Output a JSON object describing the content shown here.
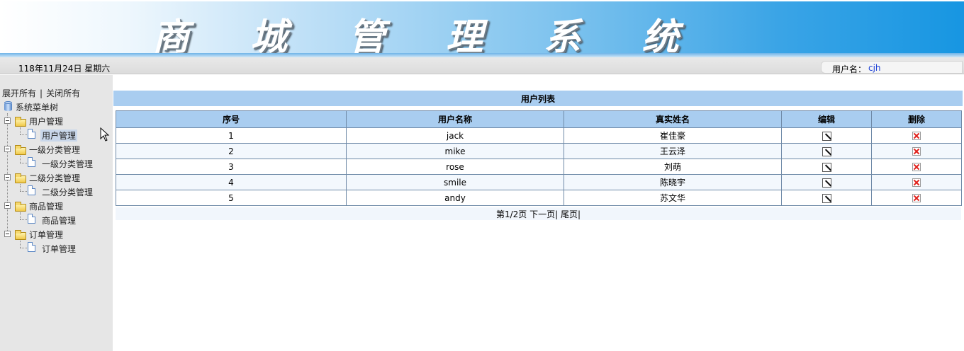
{
  "header": {
    "title": "商 城 管 理 系 统"
  },
  "status_bar": {
    "date": "118年11月24日 星期六",
    "user_label": "用户名：",
    "user_name": "cjh"
  },
  "sidebar": {
    "expand_all": "展开所有",
    "separator": "|",
    "collapse_all": "关闭所有",
    "root_label": "系统菜单树",
    "groups": [
      {
        "label": "用户管理",
        "child": "用户管理"
      },
      {
        "label": "一级分类管理",
        "child": "一级分类管理"
      },
      {
        "label": "二级分类管理",
        "child": "二级分类管理"
      },
      {
        "label": "商品管理",
        "child": "商品管理"
      },
      {
        "label": "订单管理",
        "child": "订单管理"
      }
    ]
  },
  "main": {
    "list_title": "用户列表",
    "columns": [
      "序号",
      "用户名称",
      "真实姓名",
      "编辑",
      "删除"
    ],
    "rows": [
      {
        "id": "1",
        "username": "jack",
        "realname": "崔佳豪"
      },
      {
        "id": "2",
        "username": "mike",
        "realname": "王云泽"
      },
      {
        "id": "3",
        "username": "rose",
        "realname": "刘萌"
      },
      {
        "id": "4",
        "username": "smile",
        "realname": "陈晓宇"
      },
      {
        "id": "5",
        "username": "andy",
        "realname": "苏文华"
      }
    ],
    "pager": {
      "page_info": "第1/2页",
      "next": "下一页",
      "sep1": "|",
      "last": "尾页",
      "sep2": "|"
    }
  },
  "icons": {
    "edit": "edit-icon",
    "delete": "delete-icon",
    "folder": "folder-icon",
    "page": "page-icon",
    "database": "database-icon"
  },
  "colors": {
    "header_accent": "#1796e2",
    "table_header": "#a9cdf0",
    "delete_red": "#e0201b",
    "username_blue": "#1a3fd6"
  }
}
